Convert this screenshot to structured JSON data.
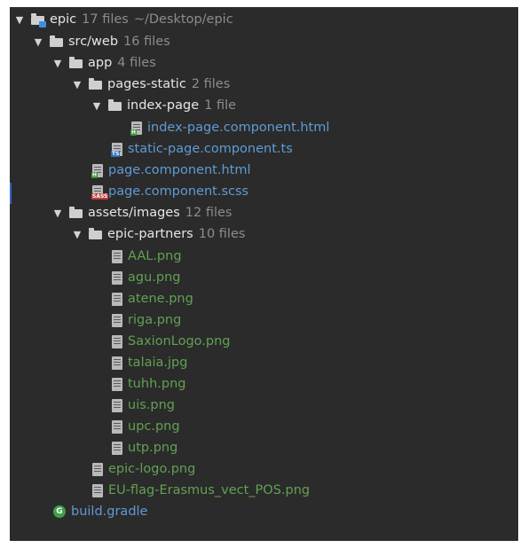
{
  "tree": {
    "root": {
      "name": "epic",
      "count": "17 files",
      "path": "~/Desktop/epic"
    },
    "src_web": {
      "name": "src/web",
      "count": "16 files"
    },
    "app": {
      "name": "app",
      "count": "4 files"
    },
    "pages_static": {
      "name": "pages-static",
      "count": "2 files"
    },
    "index_page": {
      "name": "index-page",
      "count": "1 file"
    },
    "index_page_html": {
      "name": "index-page.component.html",
      "badge": "H"
    },
    "static_page_ts": {
      "name": "static-page.component.ts",
      "badge": "TS"
    },
    "page_html": {
      "name": "page.component.html",
      "badge": "H"
    },
    "page_scss": {
      "name": "page.component.scss",
      "badge": "SASS"
    },
    "assets_images": {
      "name": "assets/images",
      "count": "12 files"
    },
    "epic_partners": {
      "name": "epic-partners",
      "count": "10 files"
    },
    "partner_files": [
      "AAL.png",
      "agu.png",
      "atene.png",
      "riga.png",
      "SaxionLogo.png",
      "talaia.jpg",
      "tuhh.png",
      "uis.png",
      "upc.png",
      "utp.png"
    ],
    "epic_logo": {
      "name": "epic-logo.png"
    },
    "eu_flag": {
      "name": "EU-flag-Erasmus_vect_POS.png"
    },
    "build_gradle": {
      "name": "build.gradle",
      "badge": "G"
    }
  },
  "icons": {
    "expanded_arrow": "▼"
  },
  "colors": {
    "background": "#2b2b2b",
    "folder_text": "#e6e6e6",
    "meta_text": "#8c8c8c",
    "html_file": "#5e9bd6",
    "image_file": "#62a053"
  }
}
